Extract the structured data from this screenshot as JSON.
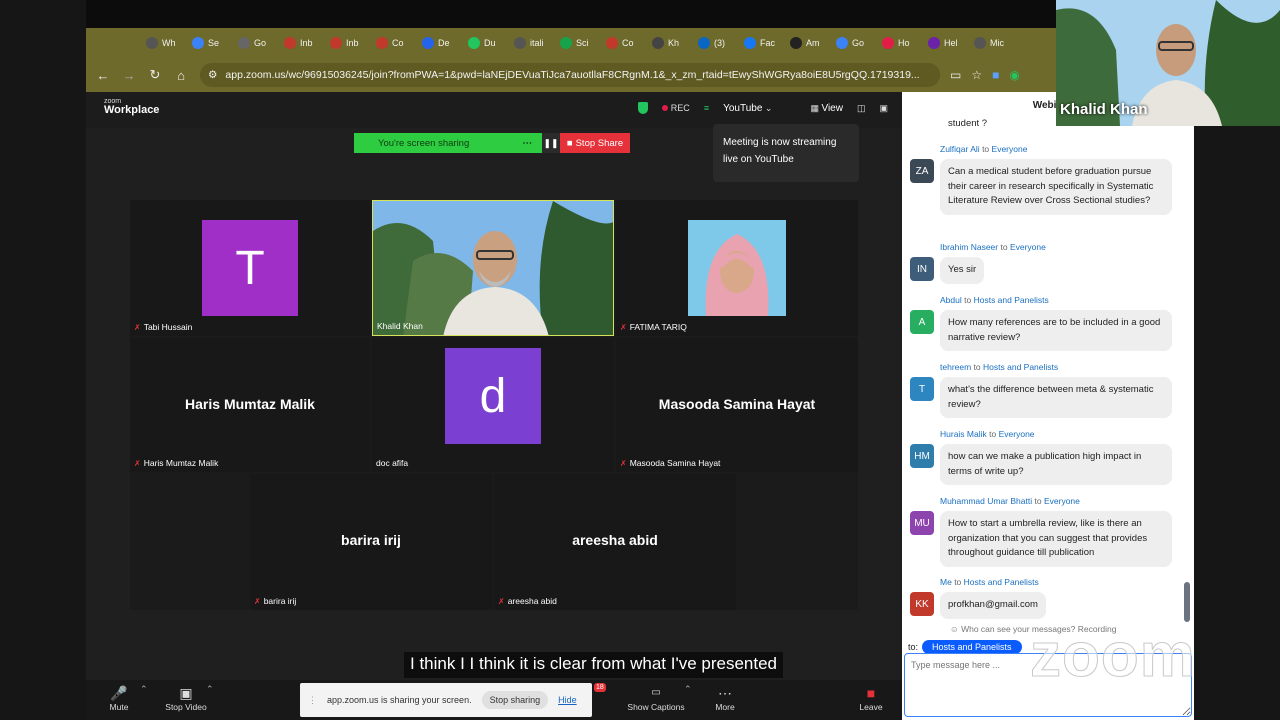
{
  "browser": {
    "tabs": [
      {
        "label": "Wh",
        "color": "#555"
      },
      {
        "label": "Se",
        "color": "#3b82f6"
      },
      {
        "label": "Go",
        "color": "#666"
      },
      {
        "label": "Inb",
        "color": "#c0392b"
      },
      {
        "label": "Inb",
        "color": "#c0392b"
      },
      {
        "label": "Co",
        "color": "#c0392b"
      },
      {
        "label": "De",
        "color": "#2563eb"
      },
      {
        "label": "Du",
        "color": "#22c55e"
      },
      {
        "label": "itali",
        "color": "#555"
      },
      {
        "label": "Sci",
        "color": "#16a34a"
      },
      {
        "label": "Co",
        "color": "#c0392b"
      },
      {
        "label": "Kh",
        "color": "#444"
      },
      {
        "label": "(3)",
        "color": "#0a66c2"
      },
      {
        "label": "Fac",
        "color": "#1877f2"
      },
      {
        "label": "Am",
        "color": "#222"
      },
      {
        "label": "Go",
        "color": "#3b82f6"
      },
      {
        "label": "Ho",
        "color": "#e11d48"
      },
      {
        "label": "Hel",
        "color": "#6b21a8"
      },
      {
        "label": "Mic",
        "color": "#555"
      }
    ],
    "url": "app.zoom.us/wc/96915036245/join?fromPWA=1&pwd=laNEjDEVuaTiJca7auotllaF8CRgnM.1&_x_zm_rtaid=tEwyShWGRya8oiE8U5rgQQ.1719319..."
  },
  "zoom": {
    "brand_small": "zoom",
    "brand_large": "Workplace",
    "rec_label": "REC",
    "youtube_label": "YouTube",
    "view_label": "View",
    "sharing_label": "You're screen sharing",
    "stop_share_label": "Stop Share",
    "stream_tooltip": "Meeting is now streaming live on YouTube"
  },
  "gallery": {
    "tiles": [
      {
        "name": "Tabi Hussain",
        "avatar": "T",
        "avatar_color": "#a02fc7"
      },
      {
        "name": "Khalid Khan"
      },
      {
        "name": "FATIMA TARIQ"
      },
      {
        "name": "Haris Mumtaz Malik",
        "display": "Haris Mumtaz Malik"
      },
      {
        "name": "doc afifa",
        "avatar": "d",
        "avatar_color": "#7b3fd1"
      },
      {
        "name": "Masooda Samina Hayat",
        "display": "Masooda Samina Hayat"
      },
      {
        "name": "barira irij",
        "display": "barira irij"
      },
      {
        "name": "areesha abid",
        "display": "areesha abid"
      }
    ]
  },
  "caption": "I think I I think it is clear from what I've presented",
  "toolbar": {
    "mute": "Mute",
    "stop_video": "Stop Video",
    "show_captions": "Show Captions",
    "more": "More",
    "leave": "Leave",
    "badge": "18",
    "sharing_text": "app.zoom.us is sharing your screen.",
    "stop_sharing": "Stop sharing",
    "hide": "Hide"
  },
  "chat": {
    "title": "Webinar",
    "partial_text": "student ?",
    "messages": [
      {
        "from": "Zulfiqar Ali",
        "to": "Everyone",
        "initials": "ZA",
        "color": "#3b4856",
        "text": "Can a medical student before graduation pursue their career in research specifically in Systematic Literature Review over Cross Sectional studies?"
      },
      {
        "from": "Ibrahim Naseer",
        "to": "Everyone",
        "initials": "IN",
        "color": "#3d5d7a",
        "text": "Yes sir"
      },
      {
        "from": "Abdul",
        "to": "Hosts and Panelists",
        "initials": "A",
        "color": "#27ae60",
        "text": "How many references are to be included in a good narrative review?"
      },
      {
        "from": "tehreem",
        "to": "Hosts and Panelists",
        "initials": "T",
        "color": "#2e86c1",
        "text": " what's the difference between meta & systematic review?"
      },
      {
        "from": "Hurais Malik",
        "to": "Everyone",
        "initials": "HM",
        "color": "#2e7dab",
        "text": "how can we make a publication high impact in terms of write up?"
      },
      {
        "from": "Muhammad Umar Bhatti",
        "to": "Everyone",
        "initials": "MU",
        "color": "#8e44ad",
        "text": "How to start a umbrella review, like is there an organization that you can suggest that provides throughout guidance till publication"
      },
      {
        "from": "Me",
        "to": "Hosts and Panelists",
        "initials": "KK",
        "color": "#c0392b",
        "text": "profkhan@gmail.com"
      }
    ],
    "to_word": "to",
    "who_can_see": "Who can see your messages? Recording",
    "to_label": "to:",
    "recipient": "Hosts and Panelists",
    "input_placeholder": "Type message here ..."
  },
  "watermark": "zoom",
  "self_view": {
    "name": "Khalid Khan"
  }
}
